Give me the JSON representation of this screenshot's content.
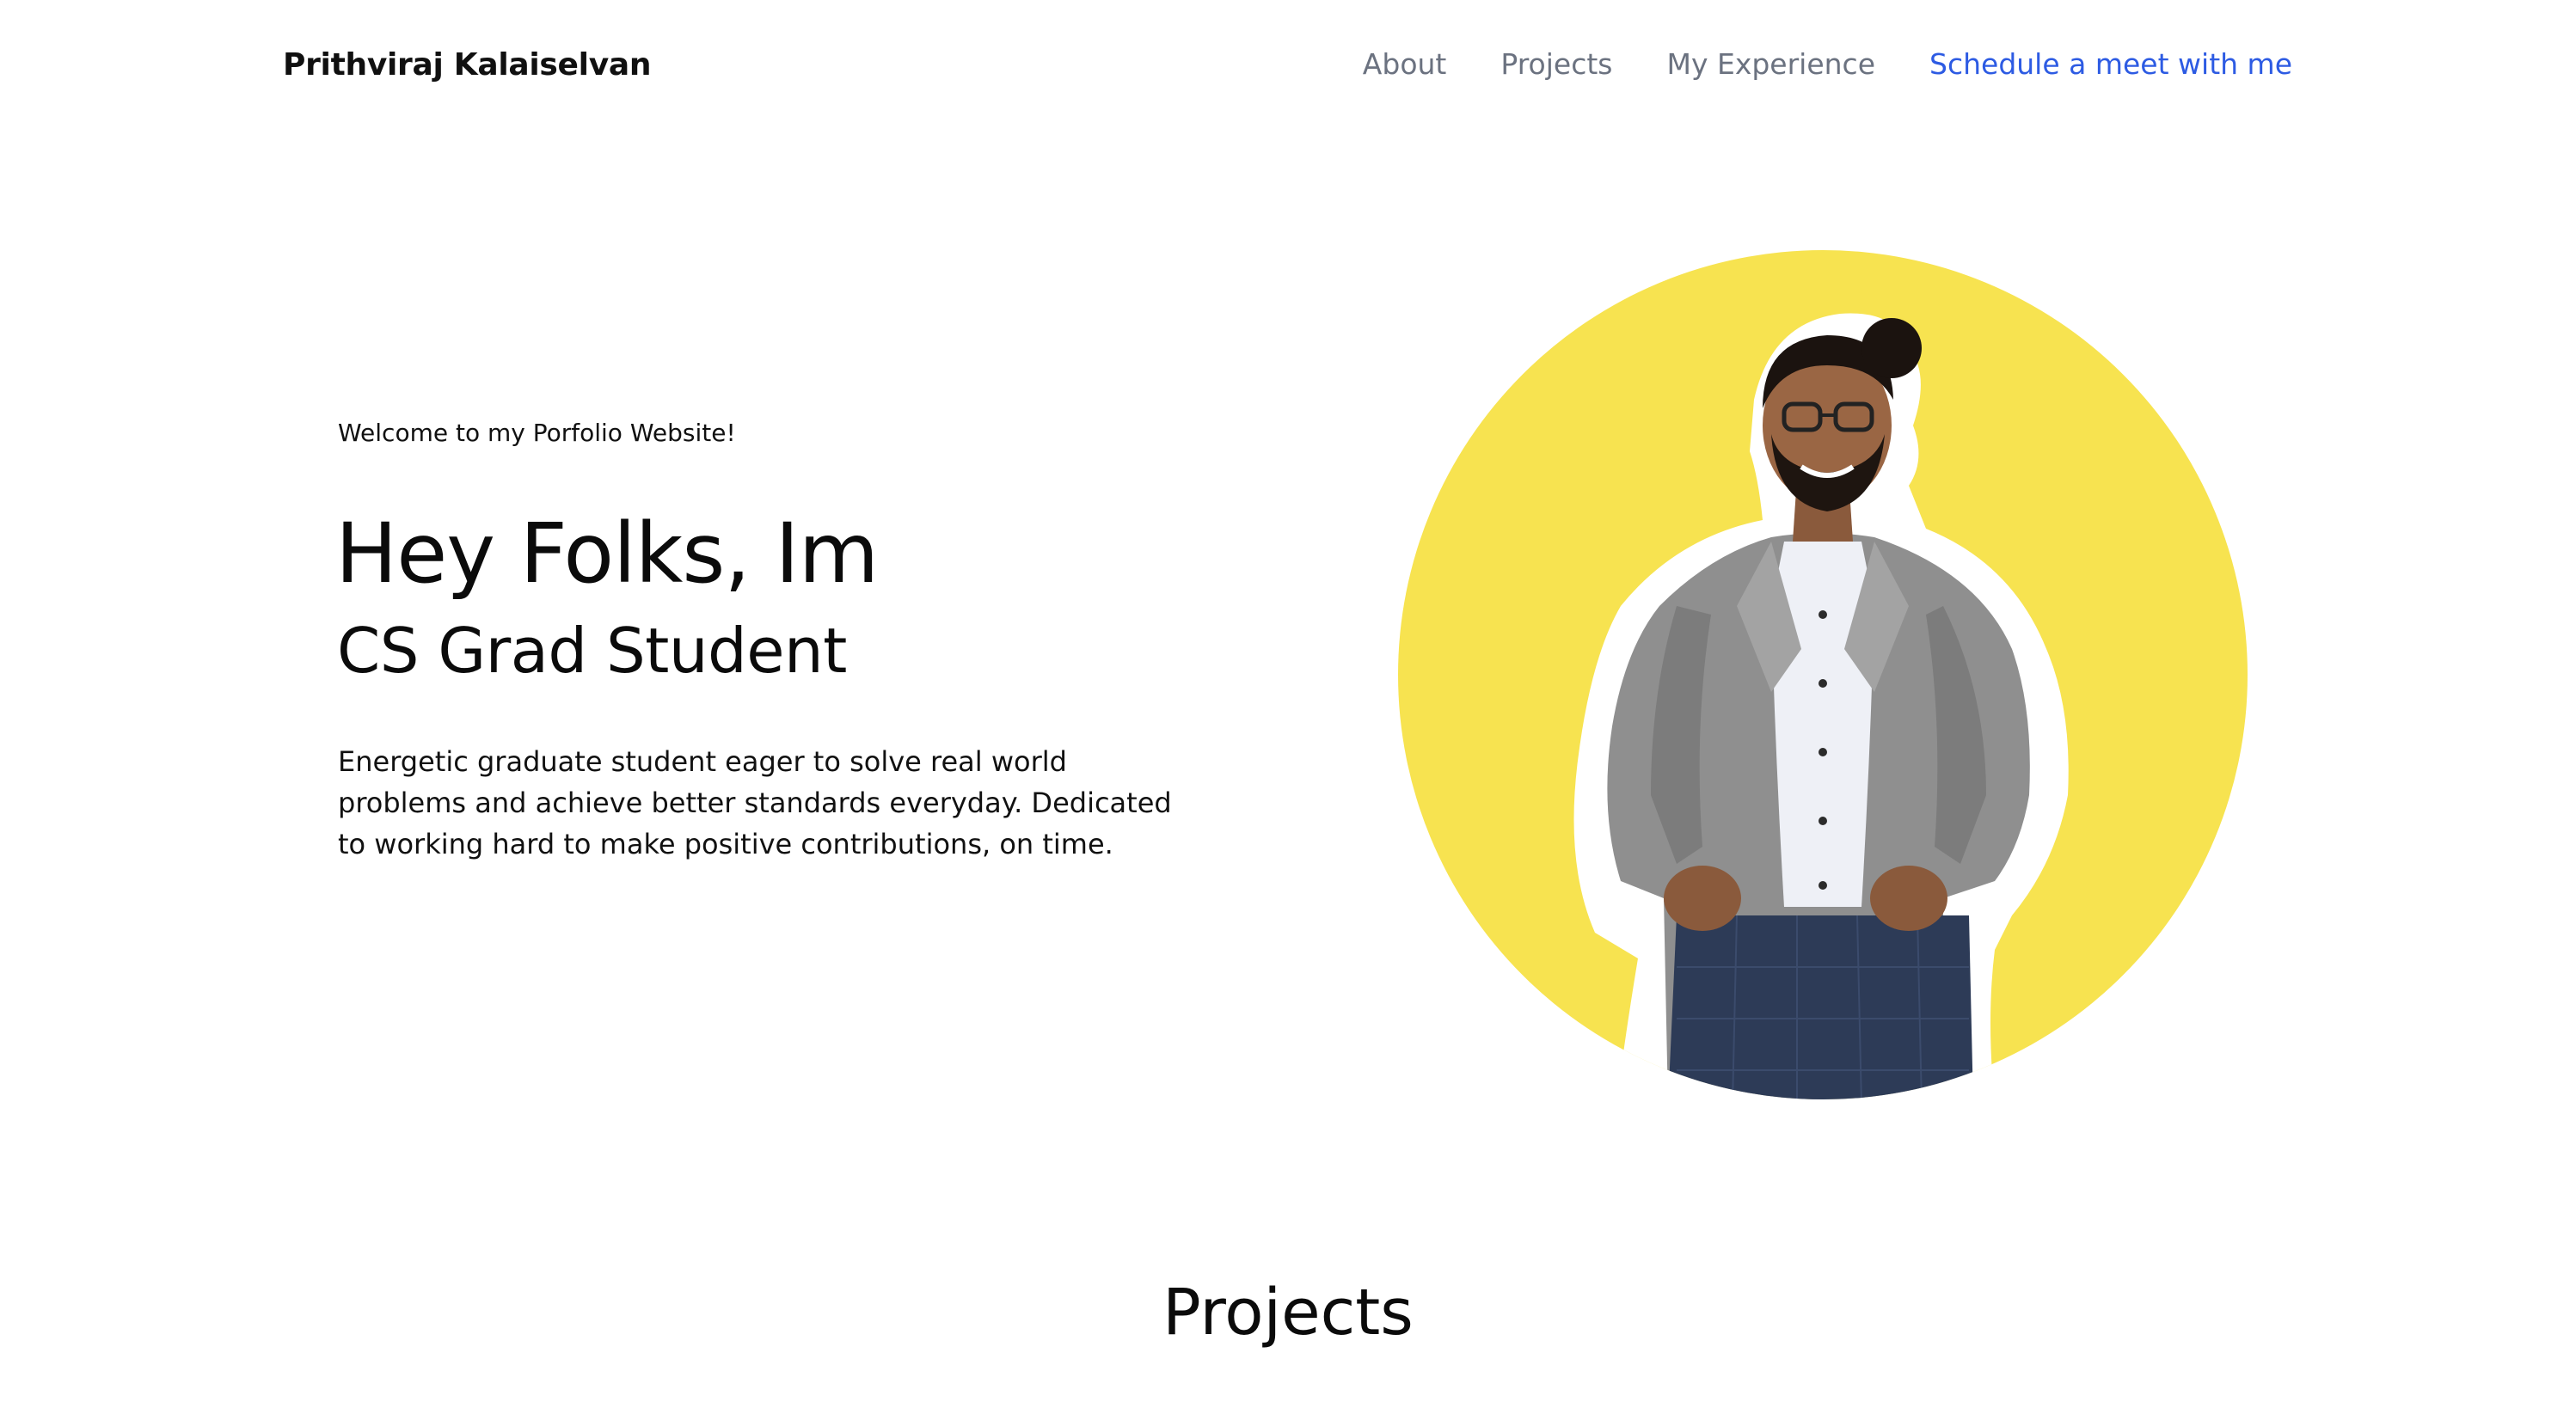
{
  "header": {
    "brand": "Prithviraj Kalaiselvan",
    "nav": [
      {
        "label": "About"
      },
      {
        "label": "Projects"
      },
      {
        "label": "My Experience"
      },
      {
        "label": "Schedule a meet with me"
      }
    ]
  },
  "hero": {
    "eyebrow": "Welcome to my Porfolio Website!",
    "headline": "Hey Folks, Im",
    "subhead": "CS Grad Student",
    "bio": "Energetic graduate student eager to solve real world problems and achieve better standards everyday. Dedicated to working hard to make positive contributions, on time.",
    "portrait_icon": "profile-photo"
  },
  "sections": {
    "projects_title": "Projects"
  },
  "colors": {
    "accent": "#2d5be3",
    "nav_text": "#6b7280",
    "circle": "#f7e350"
  }
}
